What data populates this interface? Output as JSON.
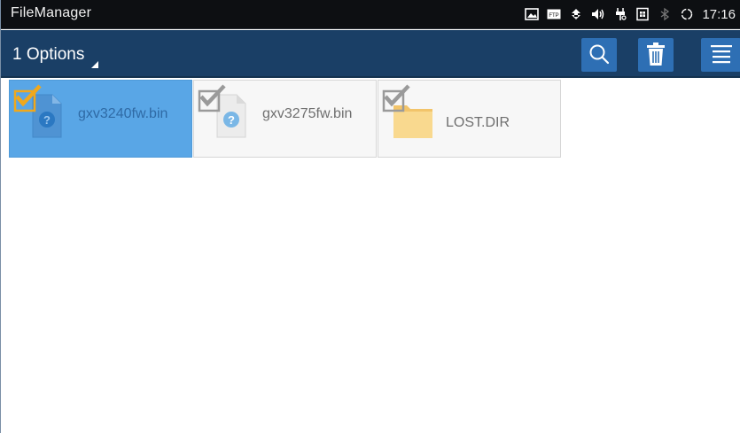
{
  "statusbar": {
    "app_title": "FileManager",
    "time": "17:16",
    "icons": [
      "image-icon",
      "ftp-icon",
      "sync-icon",
      "volume-icon",
      "usb-icon",
      "sim-icon",
      "bluetooth-icon",
      "rotate-icon"
    ],
    "ftp_label": "FTP"
  },
  "actionbar": {
    "options_label": "1 Options",
    "buttons": [
      "search-icon",
      "trash-icon",
      "menu-icon"
    ],
    "accent": "#2e6fb4",
    "background": "#1a3f66"
  },
  "files": [
    {
      "name": "gxv3240fw.bin",
      "type": "unknown-file",
      "selected": true
    },
    {
      "name": "gxv3275fw.bin",
      "type": "unknown-file",
      "selected": false
    },
    {
      "name": "LOST.DIR",
      "type": "folder",
      "selected": false
    }
  ],
  "colors": {
    "selected_tile": "#59a6e6",
    "check_selected": "#f0a81c",
    "check_unselected": "#9a9a9a",
    "folder": "#f7cf7a"
  }
}
